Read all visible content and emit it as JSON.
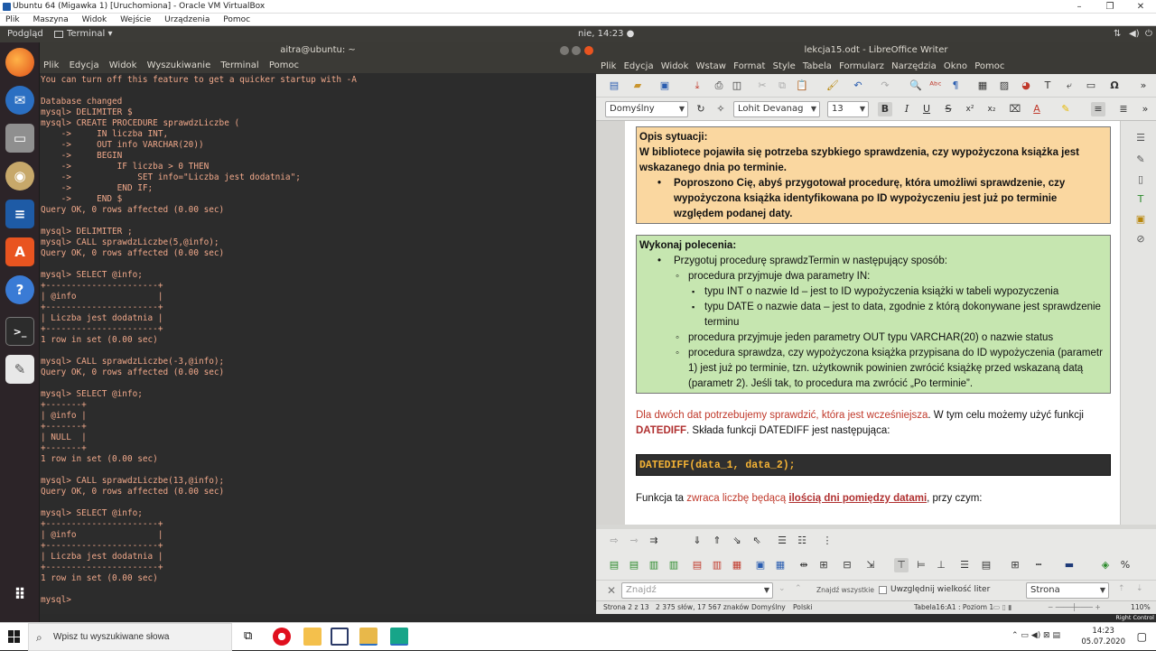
{
  "vbox": {
    "title": "Ubuntu 64 (Migawka 1) [Uruchomiona] - Oracle VM VirtualBox",
    "menu": [
      "Plik",
      "Maszyna",
      "Widok",
      "Wejście",
      "Urządzenia",
      "Pomoc"
    ]
  },
  "top_panel": {
    "activities": "Podgląd",
    "app": "Terminal ▾",
    "clock": "nie, 14:23 ●"
  },
  "terminal": {
    "title": "aitra@ubuntu: ~",
    "menu": [
      "Plik",
      "Edycja",
      "Widok",
      "Wyszukiwanie",
      "Terminal",
      "Pomoc"
    ],
    "text": "You can turn off this feature to get a quicker startup with -A\n\nDatabase changed\nmysql> DELIMITER $\nmysql> CREATE PROCEDURE sprawdzLiczbe (\n    ->     IN liczba INT,\n    ->     OUT info VARCHAR(20))\n    ->     BEGIN\n    ->         IF liczba > 0 THEN\n    ->             SET info=\"Liczba jest dodatnia\";\n    ->         END IF;\n    ->     END $\nQuery OK, 0 rows affected (0.00 sec)\n\nmysql> DELIMITER ;\nmysql> CALL sprawdzLiczbe(5,@info);\nQuery OK, 0 rows affected (0.00 sec)\n\nmysql> SELECT @info;\n+----------------------+\n| @info                |\n+----------------------+\n| Liczba jest dodatnia |\n+----------------------+\n1 row in set (0.00 sec)\n\nmysql> CALL sprawdzLiczbe(-3,@info);\nQuery OK, 0 rows affected (0.00 sec)\n\nmysql> SELECT @info;\n+-------+\n| @info |\n+-------+\n| NULL  |\n+-------+\n1 row in set (0.00 sec)\n\nmysql> CALL sprawdzLiczbe(13,@info);\nQuery OK, 0 rows affected (0.00 sec)\n\nmysql> SELECT @info;\n+----------------------+\n| @info                |\n+----------------------+\n| Liczba jest dodatnia |\n+----------------------+\n1 row in set (0.00 sec)\n\nmysql> "
  },
  "writer": {
    "title": "lekcja15.odt - LibreOffice Writer",
    "menu": [
      "Plik",
      "Edycja",
      "Widok",
      "Wstaw",
      "Format",
      "Style",
      "Tabela",
      "Formularz",
      "Narzędzia",
      "Okno",
      "Pomoc"
    ],
    "style_combo": "Domyślny",
    "font_combo": "Lohit Devanag",
    "size_combo": "13",
    "box1": {
      "heading": "Opis sytuacji:",
      "body": "W bibliotece pojawiła się potrzeba szybkiego sprawdzenia, czy wypożyczona książka jest wskazanego dnia po terminie.",
      "bullet": "Poproszono Cię, abyś przygotował procedurę, która umożliwi sprawdzenie, czy wypożyczona książka identyfikowana po ID wypożyczeniu jest już po terminie względem podanej daty."
    },
    "box2": {
      "heading": "Wykonaj polecenia:",
      "bullet": "Przygotuj procedurę sprawdzTermin w następujący sposób:",
      "sub1": "procedura przyjmuje dwa parametry IN:",
      "sub1a": "typu INT o nazwie Id – jest to ID wypożyczenia książki w tabeli wypozyczenia",
      "sub1b": "typu DATE o nazwie data – jest to data, zgodnie z którą dokonywane jest sprawdzenie terminu",
      "sub2": "procedura przyjmuje jeden parametry OUT typu VARCHAR(20) o nazwie status",
      "sub3": "procedura sprawdza, czy wypożyczona książka przypisana do ID wypożyczenia (parametr 1) jest już po terminie, tzn. użytkownik powinien zwrócić książkę przed wskazaną datą (parametr 2). Jeśli tak, to procedura ma zwrócić „Po terminie”."
    },
    "para1_red": "Dla dwóch dat potrzebujemy sprawdzić, która jest wcześniejsza",
    "para1_rest": ". W tym celu możemy użyć funkcji",
    "para1_func": "DATEDIFF",
    "para1_tail": ". Składa funkcji DATEDIFF jest następująca:",
    "code": "DATEDIFF(data_1, data_2);",
    "para2_a": "Funkcja ta ",
    "para2_b": "zwraca liczbę będącą ",
    "para2_c": "ilością dni pomiędzy datami",
    "para2_d": ", przy czym:",
    "find_placeholder": "Znajdź",
    "find_all": "Znajdź wszystkie",
    "match_case": "Uwzględnij wielkość liter",
    "find_scope": "Strona",
    "status": {
      "page": "Strona 2 z 13",
      "words": "2 375 słów, 17 567 znaków",
      "style": "Domyślny",
      "lang": "Polski",
      "table": "Tabela16:A1 : Poziom 1",
      "zoom": "110%"
    }
  },
  "taskbar": {
    "search_placeholder": "Wpisz tu wyszukiwane słowa",
    "time": "14:23",
    "date": "05.07.2020",
    "right_control": "Right Control"
  },
  "colors": {
    "terminal_text": "#f0a88a",
    "box1_bg": "#fad7a0",
    "box2_bg": "#c6e6b0",
    "code_text": "#f5b335"
  }
}
